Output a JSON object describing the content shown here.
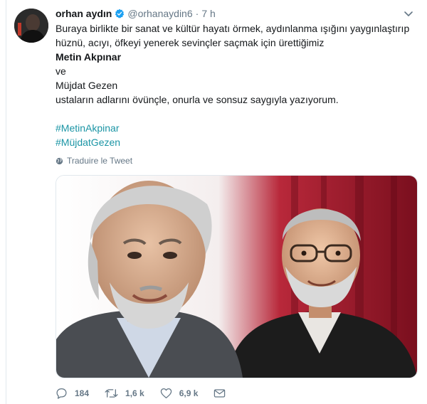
{
  "author": {
    "name": "orhan aydın",
    "handle": "@orhanaydin6",
    "separator": "·",
    "time": "7 h"
  },
  "tweet": {
    "lines": [
      "Buraya birlikte bir sanat ve kültür  hayatı örmek, aydınlanma ışığını yaygınlaştırıp",
      "hüznü, acıyı, öfkeyi yenerek sevinçler saçmak için ürettiğimiz",
      "Metin Akpınar",
      "ve",
      "Müjdat Gezen",
      "ustaların adlarını övünçle, onurla ve sonsuz saygıyla yazıyorum.",
      "",
      "#MetinAkpinar",
      "#MüjdatGezen"
    ]
  },
  "translate_label": "Traduire le Tweet",
  "actions": {
    "replies": "184",
    "retweets": "1,6 k",
    "likes": "6,9 k"
  },
  "icons": {
    "verified": "verified-badge-icon",
    "caret": "chevron-down-icon",
    "globe": "globe-icon",
    "reply": "reply-icon",
    "retweet": "retweet-icon",
    "like": "heart-icon",
    "dm": "envelope-icon"
  },
  "colors": {
    "accent": "#1da1f2",
    "hashtag": "#1b95a5",
    "muted": "#657786"
  }
}
